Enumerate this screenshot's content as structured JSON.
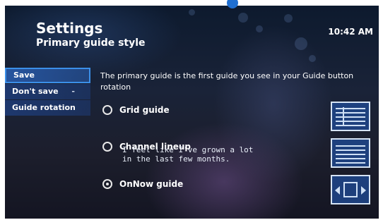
{
  "header": {
    "title": "Settings",
    "subtitle": "Primary guide style",
    "clock": "10:42 AM"
  },
  "menu": {
    "items": [
      {
        "label": "Save",
        "selected": true
      },
      {
        "label": "Don't save",
        "selected": false
      },
      {
        "label": "Guide rotation",
        "selected": false
      }
    ]
  },
  "description": "The primary guide is the first guide you see in your Guide button rotation",
  "options": [
    {
      "label": "Grid guide",
      "checked": false
    },
    {
      "label": "Channel lineup",
      "checked": false
    },
    {
      "label": "OnNow guide",
      "checked": true
    }
  ],
  "caption": "I feel like I've grown a lot\nin the last few months.",
  "icons": {
    "grid_preview": "grid-guide-icon",
    "lineup_preview": "channel-lineup-icon",
    "onnow_preview": "onnow-guide-icon"
  },
  "colors": {
    "accent": "#3b8fe8",
    "menu_bg": "#1e3c78",
    "dot": "#1f6fd1"
  }
}
